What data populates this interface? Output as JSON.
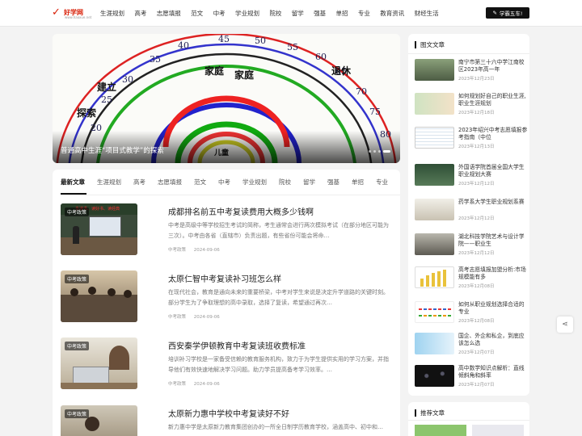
{
  "header": {
    "logo_text": "好学网",
    "logo_sub": "www.haoxue.net",
    "nav": [
      "生涯规划",
      "高考",
      "志愿填报",
      "范文",
      "中考",
      "学业规划",
      "院校",
      "留学",
      "强基",
      "单招",
      "专业",
      "教育资讯",
      "财经生活"
    ],
    "cta": "学霸五车!"
  },
  "banner": {
    "caption": "普通高中生涯“项目式教学”的探索",
    "slides": 4,
    "active_slide": 4,
    "image_labels": [
      "20",
      "25",
      "30",
      "35",
      "40",
      "45",
      "50",
      "55",
      "60",
      "65",
      "70",
      "75",
      "80",
      "家庭",
      "家庭",
      "退休",
      "建立",
      "探索",
      "儿童"
    ]
  },
  "tabs": {
    "items": [
      "最新文章",
      "生涯规划",
      "高考",
      "志愿填报",
      "范文",
      "中考",
      "学业规划",
      "院校",
      "留学",
      "强基",
      "单招",
      "专业"
    ],
    "active": "最新文章"
  },
  "articles": [
    {
      "tag": "中考政策",
      "title": "成都排名前五中考复读费用大概多少钱啊",
      "desc": "中考是高级中等学校招生考试的简称，考生通常会进行两次模拟考试（在部分地区可能为三次）。中考由各省（直辖市）负责出题，有些省份可能会将命…",
      "category": "中考政策",
      "date": "2024-09-06",
      "thumb_banner": "多读书、读好书、读经典"
    },
    {
      "tag": "中考政策",
      "title": "太原仁智中考复读补习班怎么样",
      "desc": "在现代社会，教育是通向未来的重要桥梁，中考对学生来说是决定升学道路的关键时刻。部分学生为了争取理想的高中录取，选择了复读，希望通过再次…",
      "category": "中考政策",
      "date": "2024-09-06"
    },
    {
      "tag": "中考政策",
      "title": "西安秦学伊顿教育中考复读班收费标准",
      "desc": "培训补习学校是一家备受信赖的教育服务机构，致力于为学生提供实用的学习方案，并指导他们有效快速地解决学习问题。助力学员提高备考学习效率。…",
      "category": "中考政策",
      "date": "2024-09-06"
    },
    {
      "tag": "中考政策",
      "title": "太原新力惠中学校中考复读好不好",
      "desc": "新力惠中学是太原新力教育集团创办的一所全日制学历教育学校，涵盖高中、初中和…",
      "category": "中考政策",
      "date": "2024-09-06"
    }
  ],
  "sidebar": {
    "heading": "图文文章",
    "items": [
      {
        "title": "南宁市第三十六中学江南校区2023年高一年",
        "date": "2023年12月23日"
      },
      {
        "title": "如何规划好自己的职业生涯,职业生涯规划",
        "date": "2023年12月18日"
      },
      {
        "title": "2023年绍兴中考志愿填报参考指南（中位",
        "date": "2023年12月13日"
      },
      {
        "title": "外国语学院首届全国大学生职业规划大赛",
        "date": "2023年12月12日"
      },
      {
        "title": "药学系大学生职业规划系赛",
        "date": "2023年12月12日"
      },
      {
        "title": "湖北科技学院艺术与设计学院——职业生",
        "date": "2023年12月12日"
      },
      {
        "title": "高考志愿填报加盟分析:市场规模能有多",
        "date": "2023年12月08日"
      },
      {
        "title": "如何从职业规划选择合适的专业",
        "date": "2023年12月08日"
      },
      {
        "title": "国企、外企和私企，到底应该怎么选",
        "date": "2023年12月07日"
      },
      {
        "title": "高中数学知识点解析：直线倾斜角和斜率",
        "date": "2023年12月07日"
      }
    ]
  },
  "recommend": {
    "heading": "推荐文章"
  },
  "share": {
    "icon": "share-icon"
  },
  "colors": {
    "accent": "#111111",
    "logo_red": "#d81e06"
  }
}
